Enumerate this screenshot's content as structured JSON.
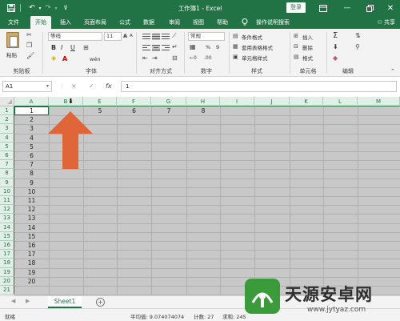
{
  "titlebar": {
    "title": "工作簿1 - Excel",
    "login_label": "登录",
    "icons": [
      "save-icon",
      "undo-icon",
      "redo-icon",
      "customize-icon",
      "ribbon-display-icon",
      "minimize-icon",
      "restore-icon",
      "close-icon"
    ]
  },
  "ribbon_tabs": {
    "items": [
      "文件",
      "开始",
      "插入",
      "页面布局",
      "公式",
      "数据",
      "审阅",
      "视图",
      "帮助"
    ],
    "active": "开始",
    "search_label": "操作说明搜索",
    "share_label": "共享"
  },
  "ribbon": {
    "clipboard": {
      "paste_label": "粘贴",
      "group_label": "剪贴板"
    },
    "font": {
      "font_name": "等线",
      "font_size": "11",
      "bold": "B",
      "italic": "I",
      "underline": "U",
      "grow": "A",
      "shrink": "A",
      "font_color": "A",
      "phonetic": "wén",
      "group_label": "字体"
    },
    "alignment": {
      "group_label": "对齐方式"
    },
    "number": {
      "format": "常规",
      "percent": "%",
      "comma": "9",
      "group_label": "数字"
    },
    "styles": {
      "conditional": "条件格式",
      "table": "套用表格格式",
      "cell": "单元格样式",
      "group_label": "样式"
    },
    "cells": {
      "insert": "插入",
      "delete": "删除",
      "format": "格式",
      "group_label": "单元格"
    },
    "editing": {
      "sum": "Σ",
      "group_label": "编辑"
    }
  },
  "formula_bar": {
    "name_box": "A1",
    "fx": "fx",
    "cancel": "×",
    "enter": "✓",
    "value": "1"
  },
  "grid": {
    "columns": [
      "A",
      "B",
      "E",
      "F",
      "G",
      "H",
      "I",
      "J",
      "K",
      "L",
      "M"
    ],
    "rows": [
      "1",
      "2",
      "3",
      "4",
      "5",
      "6",
      "7",
      "8",
      "9",
      "10",
      "11",
      "12",
      "13",
      "14",
      "15",
      "16",
      "17",
      "18",
      "19",
      "20",
      "21"
    ],
    "col_a_values": [
      "1",
      "2",
      "3",
      "4",
      "5",
      "6",
      "7",
      "8",
      "9",
      "10",
      "11",
      "12",
      "13",
      "14",
      "15",
      "16",
      "17",
      "18",
      "19",
      "20"
    ],
    "row1_values": {
      "E": "5",
      "F": "6",
      "G": "7",
      "H": "8"
    }
  },
  "sheets": {
    "tabs": [
      "Sheet1"
    ],
    "active": "Sheet1",
    "add_label": "+"
  },
  "status": {
    "ready": "就绪",
    "average": "平均值: 9.074074074",
    "count": "计数: 27",
    "sum": "求和: 245"
  },
  "watermark": {
    "title": "天源安卓网",
    "url": "www.jytyaz.com"
  }
}
